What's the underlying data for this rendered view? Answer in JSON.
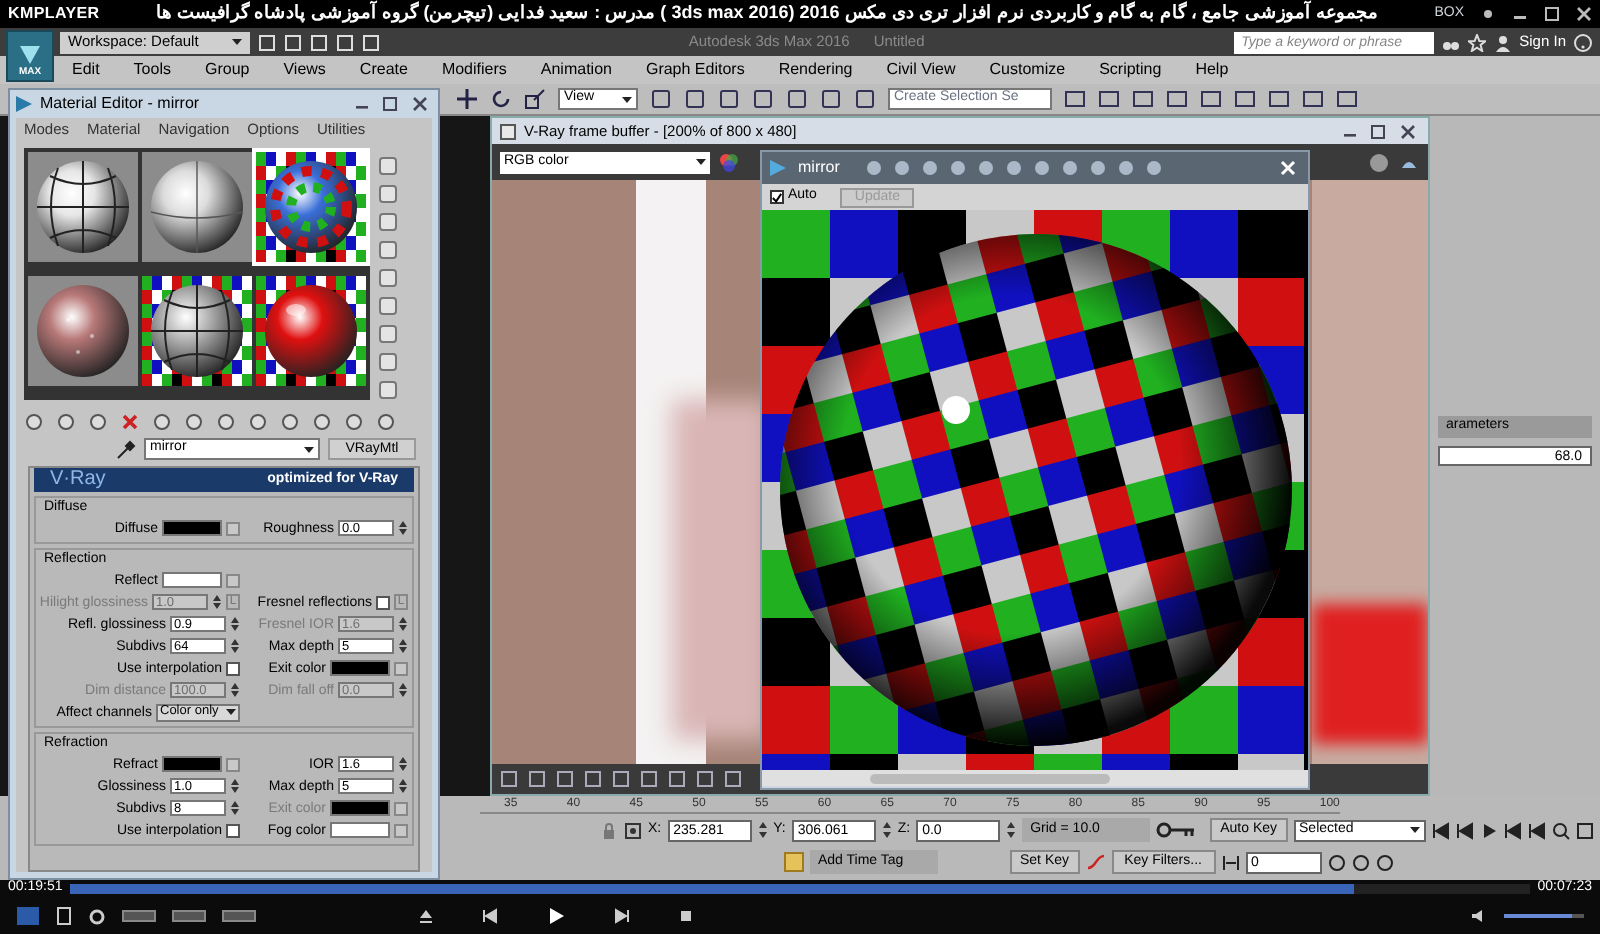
{
  "player": {
    "logo": "KMPLAYER",
    "title": "مجموعه آموزشی جامع ، گام به گام و کاربردی نرم افزار تری دی مکس 2016 (3ds max 2016 ) مدرس : سعید فدایی (تیچرمن) گروه آموزشی پادشاه گرافیست ها",
    "box": "BOX",
    "elapsed": "00:19:51",
    "remaining": "00:07:23",
    "progress": {
      "level": 0.88
    },
    "volume": {
      "level": 0.85
    }
  },
  "app": {
    "logo": "MAX",
    "workspace": "Workspace: Default",
    "title": "Autodesk 3ds Max 2016",
    "document": "Untitled",
    "search": {
      "placeholder": "Type a keyword or phrase"
    },
    "sign_in": "Sign In",
    "menu": [
      "Edit",
      "Tools",
      "Group",
      "Views",
      "Create",
      "Modifiers",
      "Animation",
      "Graph Editors",
      "Rendering",
      "Civil View",
      "Customize",
      "Scripting",
      "Help"
    ],
    "toolbar": {
      "view": "View",
      "selection_set": "Create Selection Se"
    }
  },
  "material_editor": {
    "title": "Material Editor - mirror",
    "menu": [
      "Modes",
      "Material",
      "Navigation",
      "Options",
      "Utilities"
    ],
    "slots": [
      {
        "kind": "lined",
        "color": "#e6e6e6",
        "checker_bg": false,
        "selected": false
      },
      {
        "kind": "plain",
        "color": "#dcdcdc",
        "checker_bg": false,
        "selected": false
      },
      {
        "kind": "mirror",
        "color": "#3a6fd8",
        "checker_bg": true,
        "selected": true
      },
      {
        "kind": "speckled",
        "color": "#b87878",
        "checker_bg": false,
        "selected": false
      },
      {
        "kind": "lined",
        "color": "#b4b4b4",
        "checker_bg": true,
        "selected": false
      },
      {
        "kind": "glossy",
        "color": "#e01010",
        "checker_bg": true,
        "selected": false
      }
    ],
    "material_name": "mirror",
    "material_type": "VRayMtl",
    "banner": {
      "logo": "V·Ray",
      "tagline": "optimized for V-Ray"
    },
    "groups": [
      {
        "title": "Diffuse",
        "rows": [
          {
            "left": {
              "label": "Diffuse",
              "kind": "swatch",
              "color": "#000000"
            },
            "right": {
              "label": "Roughness",
              "kind": "spinner",
              "value": "0.0",
              "disabled": false
            }
          }
        ]
      },
      {
        "title": "Reflection",
        "rows": [
          {
            "left": {
              "label": "Reflect",
              "kind": "swatch",
              "color": "#ffffff"
            }
          },
          {
            "left": {
              "label": "Hilight glossiness",
              "kind": "spinner",
              "value": "1.0",
              "disabled": true,
              "lock": "L"
            },
            "right": {
              "label": "Fresnel reflections",
              "kind": "check",
              "checked": false,
              "lock": "L"
            }
          },
          {
            "left": {
              "label": "Refl. glossiness",
              "kind": "spinner",
              "value": "0.9",
              "disabled": false
            },
            "right": {
              "label": "Fresnel IOR",
              "kind": "spinner",
              "value": "1.6",
              "disabled": true
            }
          },
          {
            "left": {
              "label": "Subdivs",
              "kind": "spinner",
              "value": "64",
              "disabled": false
            },
            "right": {
              "label": "Max depth",
              "kind": "spinner",
              "value": "5",
              "disabled": false
            }
          },
          {
            "left": {
              "label": "Use interpolation",
              "kind": "check",
              "checked": false
            },
            "right": {
              "label": "Exit color",
              "kind": "swatch",
              "color": "#000000"
            }
          },
          {
            "left": {
              "label": "Dim distance",
              "kind": "spinner",
              "value": "100.0",
              "disabled": true
            },
            "right": {
              "label": "Dim fall off",
              "kind": "spinner",
              "value": "0.0",
              "disabled": true
            }
          },
          {
            "left": {
              "label": "Affect channels",
              "kind": "dropdown",
              "value": "Color only"
            }
          }
        ]
      },
      {
        "title": "Refraction",
        "rows": [
          {
            "left": {
              "label": "Refract",
              "kind": "swatch",
              "color": "#000000"
            },
            "right": {
              "label": "IOR",
              "kind": "spinner",
              "value": "1.6",
              "disabled": false
            }
          },
          {
            "left": {
              "label": "Glossiness",
              "kind": "spinner",
              "value": "1.0",
              "disabled": false
            },
            "right": {
              "label": "Max depth",
              "kind": "spinner",
              "value": "5",
              "disabled": false
            }
          },
          {
            "left": {
              "label": "Subdivs",
              "kind": "spinner",
              "value": "8",
              "disabled": false
            },
            "right": {
              "label": "Exit color",
              "kind": "swatch",
              "color": "#000000",
              "disabled": true
            }
          },
          {
            "left": {
              "label": "Use interpolation",
              "kind": "check",
              "checked": false
            },
            "right": {
              "label": "Fog color",
              "kind": "swatch",
              "color": "#ffffff"
            }
          }
        ]
      }
    ]
  },
  "frame_buffer": {
    "title": "V-Ray frame buffer - [200% of 800 x 480]",
    "channel": "RGB color"
  },
  "preview_window": {
    "title": "mirror",
    "auto": {
      "label": "Auto",
      "checked": true
    },
    "update": {
      "label": "Update",
      "disabled": true
    }
  },
  "command_panel": {
    "heading": "arameters",
    "value": "68.0"
  },
  "status": {
    "ruler": [
      "35",
      "40",
      "45",
      "50",
      "55",
      "60",
      "65",
      "70",
      "75",
      "80",
      "85",
      "90",
      "95",
      "100"
    ],
    "x": {
      "label": "X:",
      "value": "235.281"
    },
    "y": {
      "label": "Y:",
      "value": "306.061"
    },
    "z": {
      "label": "Z:",
      "value": "0.0"
    },
    "grid": "Grid = 10.0",
    "add_time_tag": "Add Time Tag",
    "auto_key": "Auto Key",
    "set_key": "Set Key",
    "key_mode": "Selected",
    "key_filters": "Key Filters...",
    "frame": "0"
  }
}
